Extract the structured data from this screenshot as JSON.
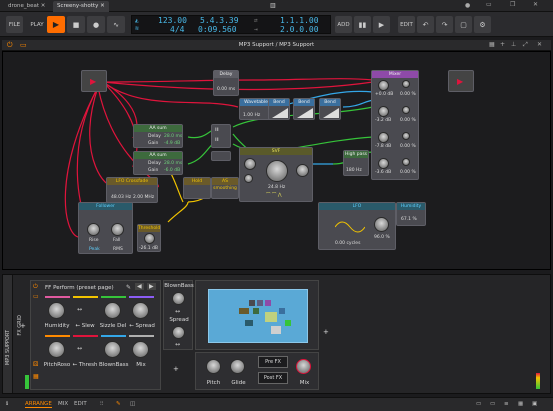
{
  "tabs": [
    {
      "label": "drone_beat"
    },
    {
      "label": "Screeny-shotty"
    }
  ],
  "transport": {
    "file": "FILE",
    "play_label": "PLAY",
    "tempo": "123.00",
    "timesig": "4/4",
    "position": "5.4.3.39",
    "time": "0:09.560",
    "loop_start": "1.1.1.00",
    "loop_len": "2.0.0.00",
    "add": "ADD",
    "edit": "EDIT"
  },
  "device": {
    "title": "MP3 Support / MP3 Support"
  },
  "nodes": {
    "delay": {
      "title": "Delay",
      "value": "0.00 ms"
    },
    "mixer": {
      "title": "Mixer",
      "values": [
        "+0.0 dB",
        "0.00 %",
        "-3.2 dB",
        "0.00 %",
        "-7.8 dB",
        "0.00 %",
        "-3.6 dB",
        "0.00 %"
      ]
    },
    "wavetable": {
      "title": "Wavetable",
      "sub": "1.00 Hz"
    },
    "bend1": {
      "title": "Bend"
    },
    "bend2": {
      "title": "Bend"
    },
    "bend3": {
      "title": "Bend"
    },
    "alias1": {
      "title": "AA sum",
      "delay_label": "Delay",
      "delay": "28.0 ms",
      "gain_label": "Gain",
      "gain": "-4.9 dB"
    },
    "alias2": {
      "title": "AA sum",
      "delay_label": "Delay",
      "delay": "28.0 ms",
      "gain_label": "Gain",
      "gain": "-6.0 dB"
    },
    "svf": {
      "title": "SVF",
      "freq": "24.8 Hz"
    },
    "highpass": {
      "title": "High pass",
      "freq": "180 Hz"
    },
    "lfo_shaper": {
      "title": "LFO Crossfade",
      "a": "48.03 Hz",
      "b": "2.00 MHz"
    },
    "hold": {
      "title": "Hold"
    },
    "ms": {
      "title": "AS smoothing"
    },
    "follower": {
      "title": "Follower",
      "rise": "Rise",
      "fall": "Fall",
      "rms": "RMS",
      "peak": "Peak"
    },
    "threshold": {
      "title": "Threshold",
      "value": "-26.1 dB"
    },
    "lfo": {
      "title": "LFO",
      "value": "0.00 cycles",
      "rate": "96.0 %"
    },
    "humidity": {
      "title": "Humidity",
      "value": "67.1 %"
    }
  },
  "bottom": {
    "side_label": "MP3 SUPPORT",
    "fxgrid_label": "FX GRID",
    "preset": "FF Perform (preset page)",
    "macros_row1": [
      "Humidity",
      "Slew",
      "Sizzle Del",
      "Spread"
    ],
    "macros_row2": [
      "PitchRoso",
      "Thresh",
      "BlownBass",
      "Mix"
    ],
    "blownbass": "BlownBass",
    "spread": "Spread",
    "pitch": "Pitch",
    "glide": "Glide",
    "pre_fx": "Pre FX",
    "post_fx": "Post FX",
    "mix": "Mix"
  },
  "status": {
    "arrange": "ARRANGE",
    "mix": "MIX",
    "edit": "EDIT"
  },
  "colors": {
    "accent": "#ff8a00",
    "lcd": "#49b9e8",
    "play": "#ff6d00",
    "cable_red": "#e0143c",
    "cable_yellow": "#f2c400",
    "cable_green": "#36c43a",
    "cable_blue": "#34a7e8"
  }
}
